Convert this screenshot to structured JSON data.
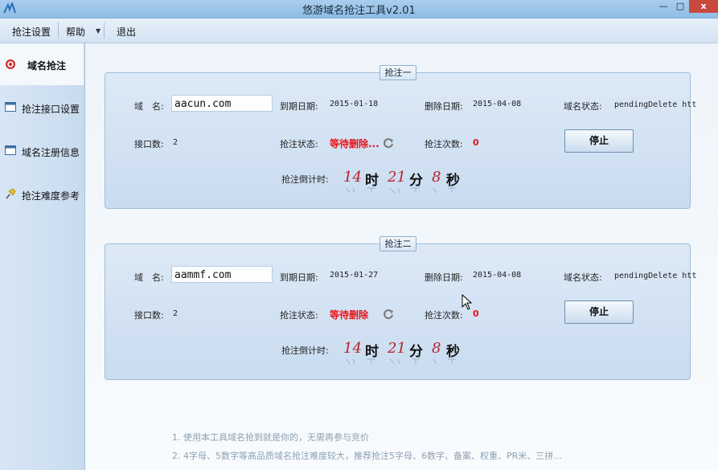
{
  "window": {
    "title": "悠游域名抢注工具v2.01",
    "minimize_label": "—",
    "maximize_label": "□",
    "close_label": "x"
  },
  "menu": [
    {
      "label": "抢注设置"
    },
    {
      "label": "帮助"
    },
    {
      "label": "退出"
    }
  ],
  "sidebar": {
    "items": [
      {
        "label": "域名抢注",
        "icon": "target-icon",
        "active": true
      },
      {
        "label": "抢注接口设置",
        "icon": "window-icon"
      },
      {
        "label": "域名注册信息",
        "icon": "window-icon"
      },
      {
        "label": "抢注难度参考",
        "icon": "pin-icon"
      }
    ]
  },
  "panels": [
    {
      "title": "抢注一",
      "domain_label": "域　名:",
      "domain": "aacun.com",
      "expire_label": "到期日期:",
      "expire": "2015-01-18",
      "delete_label": "删除日期:",
      "delete": "2015-04-08",
      "state_label": "域名状态:",
      "state": "pendingDelete htt",
      "ports_label": "接口数:",
      "ports": "2",
      "status_label": "抢注状态:",
      "status": "等待删除...",
      "attempts_label": "抢注次数:",
      "attempts": "0",
      "stop_label": "停止",
      "countdown_label": "抢注倒计时:",
      "countdown": {
        "h": "14",
        "h_unit": "时",
        "m": "21",
        "m_unit": "分",
        "s": "8",
        "s_unit": "秒"
      }
    },
    {
      "title": "抢注二",
      "domain_label": "域　名:",
      "domain": "aammf.com",
      "expire_label": "到期日期:",
      "expire": "2015-01-27",
      "delete_label": "删除日期:",
      "delete": "2015-04-08",
      "state_label": "域名状态:",
      "state": "pendingDelete htt",
      "ports_label": "接口数:",
      "ports": "2",
      "status_label": "抢注状态:",
      "status": "等待删除",
      "attempts_label": "抢注次数:",
      "attempts": "0",
      "stop_label": "停止",
      "countdown_label": "抢注倒计时:",
      "countdown": {
        "h": "14",
        "h_unit": "时",
        "m": "21",
        "m_unit": "分",
        "s": "8",
        "s_unit": "秒"
      }
    }
  ],
  "footer_notes": [
    "1.  使用本工具域名抢到就是你的，无需再参与竞价",
    "2.  4字母、5数字等高品质域名抢注难度较大，推荐抢注5字母、6数字、备案、权重、PR米、三拼..."
  ],
  "colors": {
    "accent_red": "#e8141b",
    "countdown_num": "#b9232a",
    "panel_bg": "#c9dcf0"
  }
}
